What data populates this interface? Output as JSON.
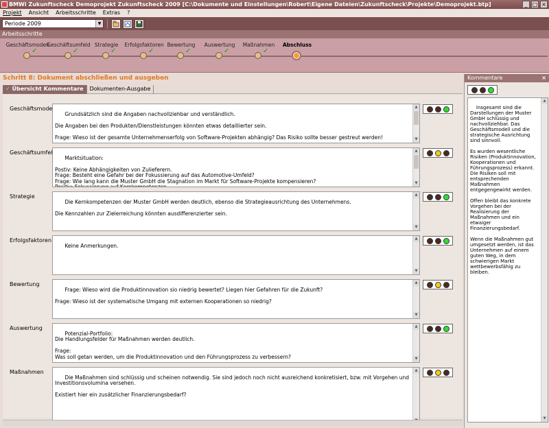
{
  "window": {
    "title": "BMWi Zukunftscheck  Demoprojekt Zukunftscheck 2009  [C:\\Dokumente und Einstellungen\\Robert\\Eigene Dateien\\Zukunftscheck\\Projekte\\Demoprojekt.btp]",
    "minimize": "_",
    "maximize": "□",
    "close": "×"
  },
  "menu": {
    "items": [
      "Projekt",
      "Ansicht",
      "Arbeitsschritte",
      "Extras",
      "?"
    ]
  },
  "toolbar": {
    "period_value": "Periode 2009",
    "dropdown_arrow": "▼",
    "btn_open_icon": "open-icon",
    "btn_export_icon": "export-icon",
    "btn_save_icon": "save-icon"
  },
  "steps": {
    "header": "Arbeitsschritte",
    "items": [
      {
        "label": "Geschäftsmodell",
        "done": "✓"
      },
      {
        "label": "Geschäftsumfeld",
        "done": "✓"
      },
      {
        "label": "Strategie",
        "done": "✓"
      },
      {
        "label": "Erfolgsfaktoren",
        "done": "✓"
      },
      {
        "label": "Bewertung",
        "done": "✓"
      },
      {
        "label": "Auswertung",
        "done": "✓"
      },
      {
        "label": "Maßnahmen",
        "done": "✓"
      },
      {
        "label": "Abschluss",
        "done": ""
      }
    ],
    "active_index": 7
  },
  "main": {
    "title": "Schritt 8: Dokument abschließen und ausgeben",
    "tabs": [
      {
        "label": "Übersicht Kommentare",
        "check": "✓"
      },
      {
        "label": "Dokumenten-Ausgabe",
        "check": ""
      }
    ]
  },
  "rows": [
    {
      "label": "Geschäftsmodell",
      "text": "Grundsätzlich sind die Angaben nachvollziehbar und verständlich.\n\nDie Angaben bei den Produkten/Dienstleistungen könnten etwas detaillierter sein.\n\nFrage: Wieso ist der gesamte Unternehmenserfolg von Software-Projekten abhängig? Das Risiko sollte besser gestreut werden!",
      "traffic": "green"
    },
    {
      "label": "Geschäftsumfeld",
      "text": "Marktsituation:\n\nPostiv: Keine Abhängigkeiten von Zulieferern.\nFrage: Besteht eine Gefahr bei der Fokussierung auf das Automotive-Umfeld?\nFrage: Wie lang kann die Muster GmbH die Stagnation im Markt für Software-Projekte kompensieren?\nPositiv: Fokussierung auf Kernkompetenzen.",
      "traffic": "yellow"
    },
    {
      "label": "Strategie",
      "text": "Die Kernkompetenzen der Muster GmbH werden deutlich, ebenso die Strategieausrichtung des Unternehmens.\n\nDie Kennzahlen zur Zielerreichung könnten ausdifferenzierter sein.",
      "traffic": "green"
    },
    {
      "label": "Erfolgsfaktoren",
      "text": "Keine Anmerkungen.",
      "traffic": "green"
    },
    {
      "label": "Bewertung",
      "text": "Frage: Wieso wird die Produktinnovation sio niedrig bewertet? Liegen hier Gefahren für die Zukunft?\n\nFrage: Wieso ist der systematische Umgang mit externen Kooperationen so niedrig?",
      "traffic": "yellow"
    },
    {
      "label": "Auswertung",
      "text": "Potenzial-Portfolio:\nDie Handlungsfelder für Maßnahmen werden deutlich.\n\nFrage:\nWas soll getan werden, um die Produktinnovation und den Führungsprozess zu verbessern?",
      "traffic": "green"
    },
    {
      "label": "Maßnahmen",
      "text": "Die Maßnahmen sind schlüssig und scheinen notwendig. Sie sind jedoch noch nicht ausreichend konkretisiert, bzw. mit Vorgehen und Investitionsvolumina versehen.\n\nExistiert hier ein zusätzlicher Finanzierungsbedarf?",
      "traffic": "yellow"
    }
  ],
  "comments": {
    "header": "Kommentare",
    "close": "×",
    "traffic": "green",
    "text": "Insgesamt sind die Darstellungen der Muster GmbH schlüssig und nachvollziehbar. Das Geschäftsmodell und die strategische Ausrichtung sind sinnvoll.\n\nEs wurden wesentliche Risiken (Produktinnovation, Kooperationen und Führungsprozess) erkannt. Die Risiken soll mit entsprechenden Maßnahmen entgegengewirkt werden.\n\nOffen bleibt das konkrete Vorgehen bei der Realisierung der Maßnahmen und ein etwaiger Finanzierungsbedarf.\n\nWenn die Maßnahmen gut umgesetzt werden, ist das Unternehmen auf einem guten Weg, in dem schwierigen Markt wettbewerbsfähig zu bleiben."
  },
  "colors": {
    "accent": "#e07820",
    "header_bg": "#9b7373",
    "steps_bg": "#caa0a6",
    "traffic_green": "#2fdf2f",
    "traffic_yellow": "#f2cc1e"
  }
}
